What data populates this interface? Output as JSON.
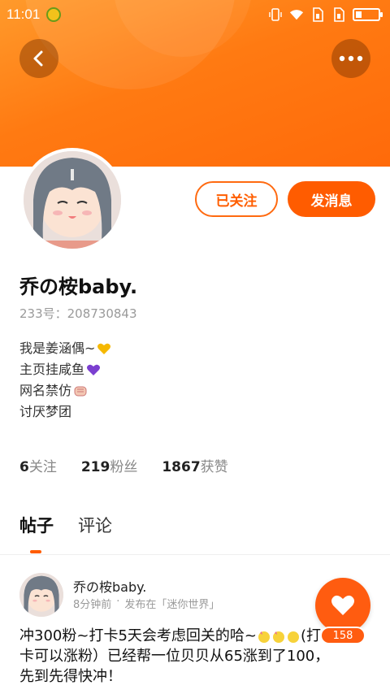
{
  "status_bar": {
    "time": "11:01",
    "icons": [
      "vibrate-icon",
      "wifi-icon",
      "sim1-icon",
      "sim2-icon",
      "battery-icon"
    ]
  },
  "header": {
    "back_icon": "chevron-left-icon",
    "more_icon": "more-dots-icon",
    "banner_color": "#ff7a12"
  },
  "profile": {
    "name": "乔の桉baby.",
    "id_text": "233号：208730843",
    "follow_button": "已关注",
    "message_button": "发消息",
    "bio": [
      {
        "text": "我是姜涵偶~",
        "emoji": "yellow-heart-icon"
      },
      {
        "text": "主页挂咸鱼",
        "emoji": "purple-heart-icon"
      },
      {
        "text": "网名禁仿",
        "emoji": "fist-icon"
      },
      {
        "text": "讨厌梦团",
        "emoji": ""
      }
    ]
  },
  "stats": [
    {
      "num": "6",
      "label": "关注"
    },
    {
      "num": "219",
      "label": "粉丝"
    },
    {
      "num": "1867",
      "label": "获赞"
    }
  ],
  "tabs": [
    {
      "label": "帖子",
      "active": true
    },
    {
      "label": "评论",
      "active": false
    }
  ],
  "post": {
    "author": "乔の桉baby.",
    "time": "8分钟前",
    "separator": "·",
    "published_in": "发布在「迷你世界」",
    "content_line1_start": "冲300粉~打卡5天会考虑回关的哈~",
    "content_line1_end": "(打",
    "content_line2": "卡可以涨粉）已经帮一位贝贝从65涨到了100，",
    "content_line3": "先到先得快冲！"
  },
  "like": {
    "count": "158",
    "accent": "#ff5c10"
  }
}
